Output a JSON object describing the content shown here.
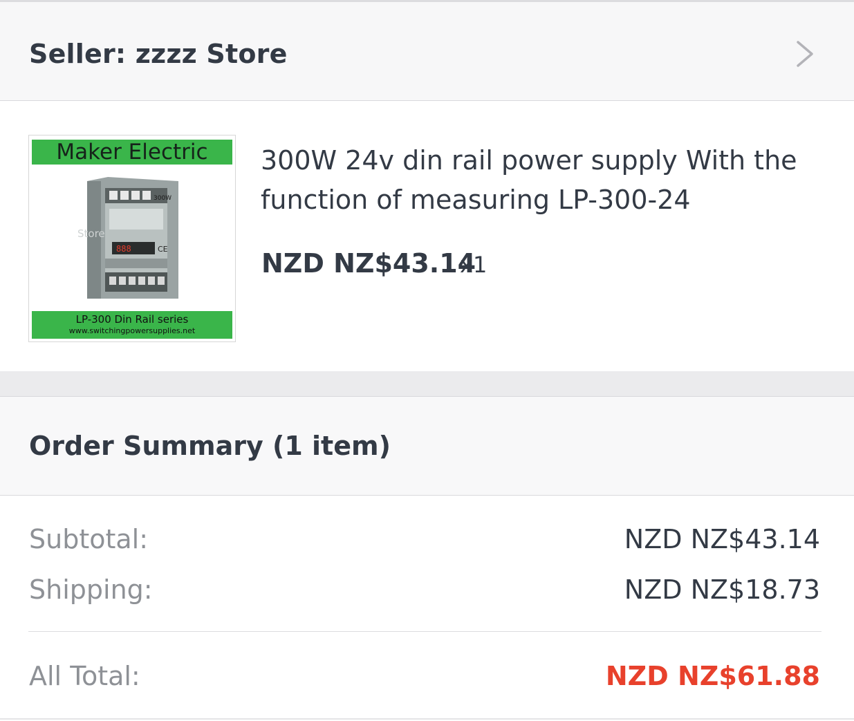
{
  "seller": {
    "label": "Seller: zzzz Store",
    "chevron_icon": "chevron-right-icon"
  },
  "product": {
    "image": {
      "brand": "Maker Electric",
      "series": "LP-300 Din Rail series",
      "url": "www.switchingpowersupplies.net"
    },
    "title": "300W 24v din rail  power supply With the function of measuring LP-300-24",
    "price": "NZD NZ$43.14",
    "quantity": "x1"
  },
  "summary": {
    "title": "Order Summary (1 item)",
    "subtotal_label": "Subtotal:",
    "subtotal_value": "NZD NZ$43.14",
    "shipping_label": "Shipping:",
    "shipping_value": "NZD NZ$18.73",
    "total_label": "All Total:",
    "total_value": "NZD NZ$61.88"
  },
  "colors": {
    "text": "#333a45",
    "muted": "#8e9196",
    "total": "#e8412c",
    "brand_green": "#3ab54a"
  }
}
